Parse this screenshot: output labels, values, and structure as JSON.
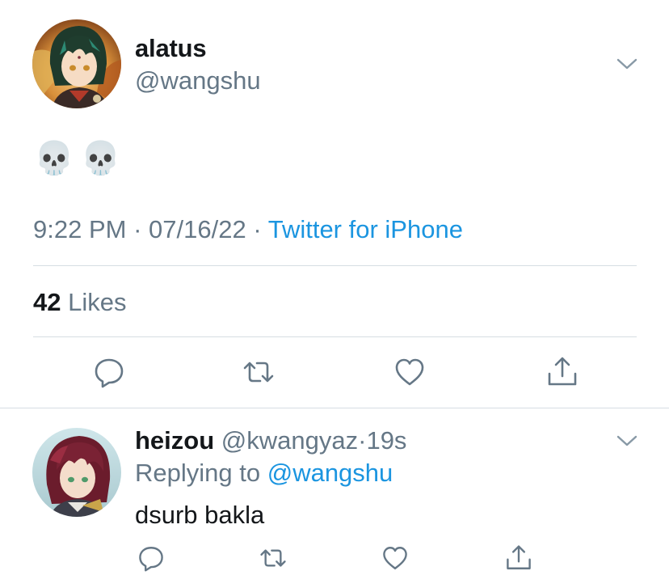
{
  "tweet": {
    "author_name": "alatus",
    "author_handle": "@wangshu",
    "body": "💀💀",
    "time": "9:22 PM",
    "date": "07/16/22",
    "separator": "·",
    "source": "Twitter for iPhone",
    "likes_count": "42",
    "likes_label": "Likes"
  },
  "reply": {
    "author_name": "heizou",
    "author_handle": "@kwangyaz",
    "separator": "·",
    "age": "19s",
    "replying_prefix": "Replying to",
    "replying_to": "@wangshu",
    "text": "dsurb bakla"
  },
  "icons": {
    "reply": "speech-bubble-icon",
    "retweet": "retweet-arrows-icon",
    "like": "heart-icon",
    "share": "share-arrow-icon",
    "more": "chevron-down-icon"
  },
  "colors": {
    "link": "#1b95e0",
    "secondary_text": "#657786",
    "icon": "#657786",
    "divider": "#d6dde3"
  }
}
